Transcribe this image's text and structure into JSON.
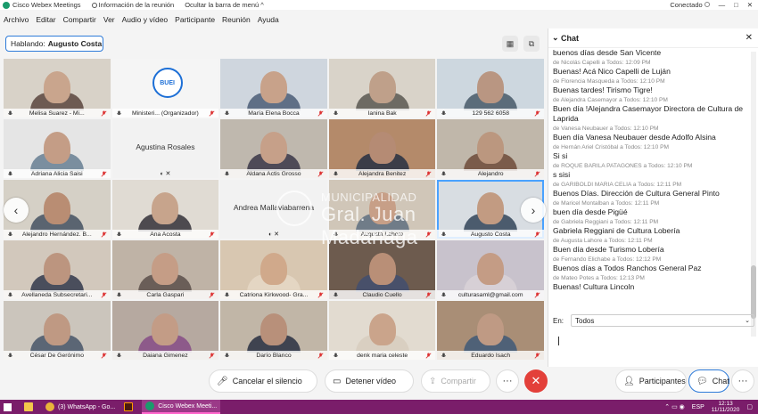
{
  "titlebar": {
    "app_title": "Cisco Webex Meetings",
    "info_label": "Información de la reunión",
    "hide_menu_label": "Ocultar la barra de menú",
    "hide_menu_arrow": "^",
    "status_label": "Conectado",
    "minimize": "—",
    "maximize": "□",
    "close": "✕"
  },
  "menu": [
    "Archivo",
    "Editar",
    "Compartir",
    "Ver",
    "Audio y vídeo",
    "Participante",
    "Reunión",
    "Ayuda"
  ],
  "speaker": {
    "prefix": "Hablando:",
    "name": "Augusto Costa"
  },
  "grid_tiles": [
    [
      "Melisa Suarez - Mi...",
      "Ministeri... (Organizador)",
      "María Elena Bocca",
      "Ianina Bak",
      "129 562 6058"
    ],
    [
      "Adriana Alicia Saisi",
      "Agustina Rosales",
      "Aldana Actis Grosso",
      "Alejandra Benitez",
      "Alejandro"
    ],
    [
      "Alejandro Hernández. B...",
      "Ana Acosta",
      "Andrea Mallaviabarrena",
      "Augusta Lahore",
      "Augusto Costa"
    ],
    [
      "Avellaneda Subsecretari...",
      "Carla Gaspari",
      "Catriona Kirkwood- Gra...",
      "Claudio Cuello",
      "culturasaml@gmail.com"
    ],
    [
      "César De Gerónimo",
      "Daiana Gimenez",
      "Darío Blanco",
      "denk maria celeste",
      "Eduardo Isach"
    ]
  ],
  "organizer_logo": "BUEI",
  "watermark": {
    "line1": "MUNICIPALIDAD",
    "line2": "Gral. Juan Madariaga"
  },
  "controls": {
    "mute": "Cancelar el silencio",
    "video": "Detener vídeo",
    "share": "Compartir",
    "more": "···",
    "hangup": "✕",
    "participants": "Participantes",
    "chat": "Chat",
    "panel_more": "···"
  },
  "chat": {
    "title": "Chat",
    "close": "✕",
    "messages": [
      {
        "from": "",
        "text": "buenos días desde San Vicente"
      },
      {
        "from": "de Nicolás Capelli a Todos:     12:09 PM",
        "text": "Buenas! Acá Nico Capelli de Luján"
      },
      {
        "from": "de Florencia Masqueda a Todos:     12:10 PM",
        "text": "Buenas tardes! Tirismo Tigre!"
      },
      {
        "from": "de Alejandra Casemayor a Todos:     12:10 PM",
        "text": "Buen día !Alejandra Casemayor  Directora de Cultura de Laprida"
      },
      {
        "from": "de Vanesa Neubauer a Todos:     12:10 PM",
        "text": "Buen día Vanesa Neubauer desde Adolfo Alsina"
      },
      {
        "from": "de Hernán Ariel Cristóbal a Todos:     12:10 PM",
        "text": "Si si"
      },
      {
        "from": "de ROQUE BARILA PATAGONES a Todos:     12:10 PM",
        "text": "s sisi"
      },
      {
        "from": "de GARIBOLDI MARIA CELIA a Todos:     12:11 PM",
        "text": "Buenos Días. Dirección de Cultura General Pinto"
      },
      {
        "from": "de Maricel Montalban a Todos:     12:11 PM",
        "text": "buen día desde Pigüé"
      },
      {
        "from": "de Gabriela Reggiani a Todos:     12:11 PM",
        "text": "Gabriela Reggiani de Cultura Lobería"
      },
      {
        "from": "de Augusta Lahore a Todos:     12:11 PM",
        "text": "Buen día desde Turismo Lobería"
      },
      {
        "from": "de Fernando Elichabe a Todos:     12:12 PM",
        "text": "Buenos días a Todos Ranchos General Paz"
      },
      {
        "from": "de Mateo Potes a Todos:     12:13 PM",
        "text": "Buenas! Cultura Lincoln"
      }
    ],
    "to_label": "En:",
    "to_value": "Todos"
  },
  "taskbar": {
    "items": [
      "(3) WhatsApp - Go...",
      "Cisco Webex Meeti..."
    ],
    "lang": "ESP",
    "time": "12:13",
    "date": "11/11/2020"
  }
}
